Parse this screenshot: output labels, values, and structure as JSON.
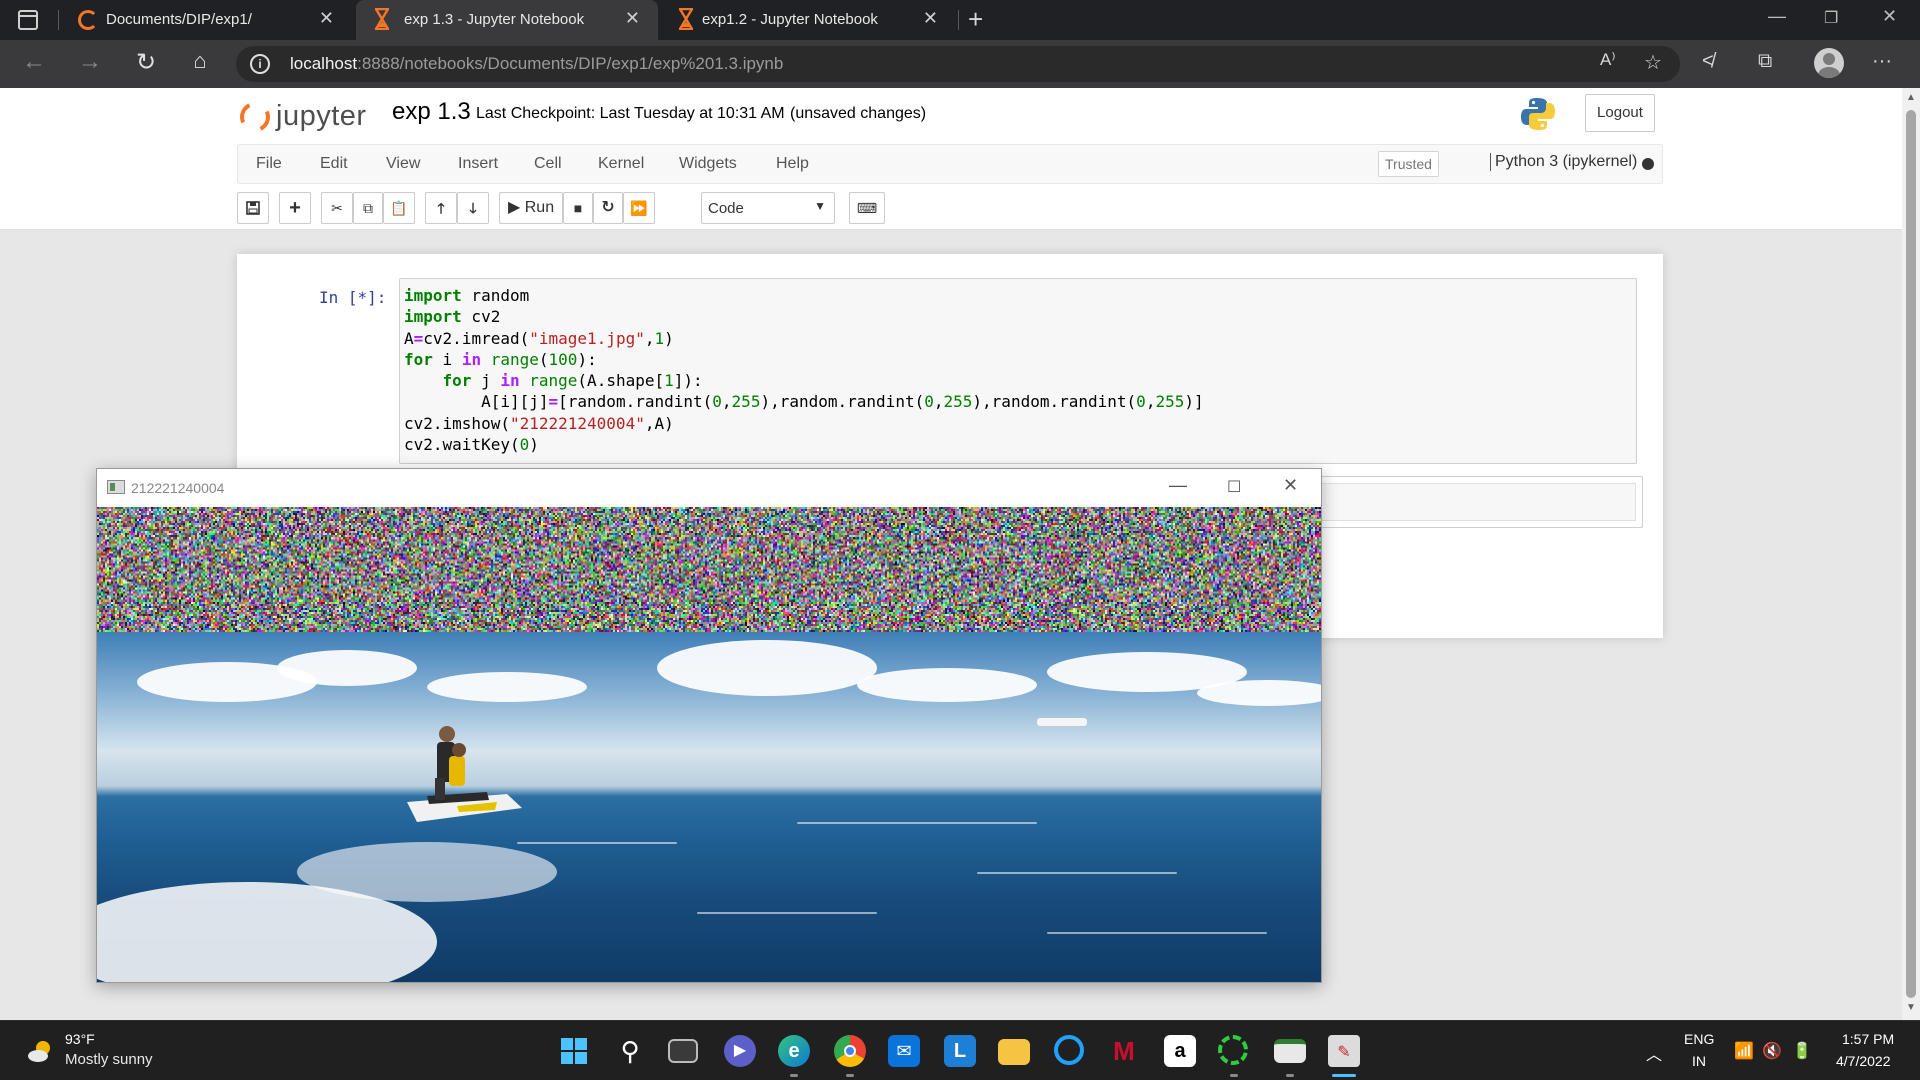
{
  "browser": {
    "tabs": [
      {
        "title": "Documents/DIP/exp1/"
      },
      {
        "title": "exp 1.3 - Jupyter Notebook"
      },
      {
        "title": "exp1.2 - Jupyter Notebook"
      }
    ],
    "url_host": "localhost",
    "url_rest": ":8888/notebooks/Documents/DIP/exp1/exp%201.3.ipynb"
  },
  "jupyter": {
    "logo_text": "jupyter",
    "notebook_name": "exp 1.3",
    "checkpoint": "Last Checkpoint: Last Tuesday at 10:31 AM",
    "unsaved": "(unsaved changes)",
    "logout": "Logout",
    "menu": [
      "File",
      "Edit",
      "View",
      "Insert",
      "Cell",
      "Kernel",
      "Widgets",
      "Help"
    ],
    "trusted": "Trusted",
    "kernel": "Python 3 (ipykernel)",
    "run_label": "Run",
    "cell_type": "Code"
  },
  "cell": {
    "prompt": "In [*]:",
    "code": [
      "import random",
      "import cv2",
      "A=cv2.imread(\"image1.jpg\",1)",
      "for i in range(100):",
      "    for j in range(A.shape[1]):",
      "        A[i][j]=[random.randint(0,255),random.randint(0,255),random.randint(0,255)]",
      "cv2.imshow(\"212221240004\",A)",
      "cv2.waitKey(0)"
    ]
  },
  "image_window": {
    "title": "212221240004"
  },
  "taskbar": {
    "weather_temp": "93°F",
    "weather_desc": "Mostly sunny",
    "lang": "ENG",
    "region": "IN",
    "time": "1:57 PM",
    "date": "4/7/2022"
  }
}
